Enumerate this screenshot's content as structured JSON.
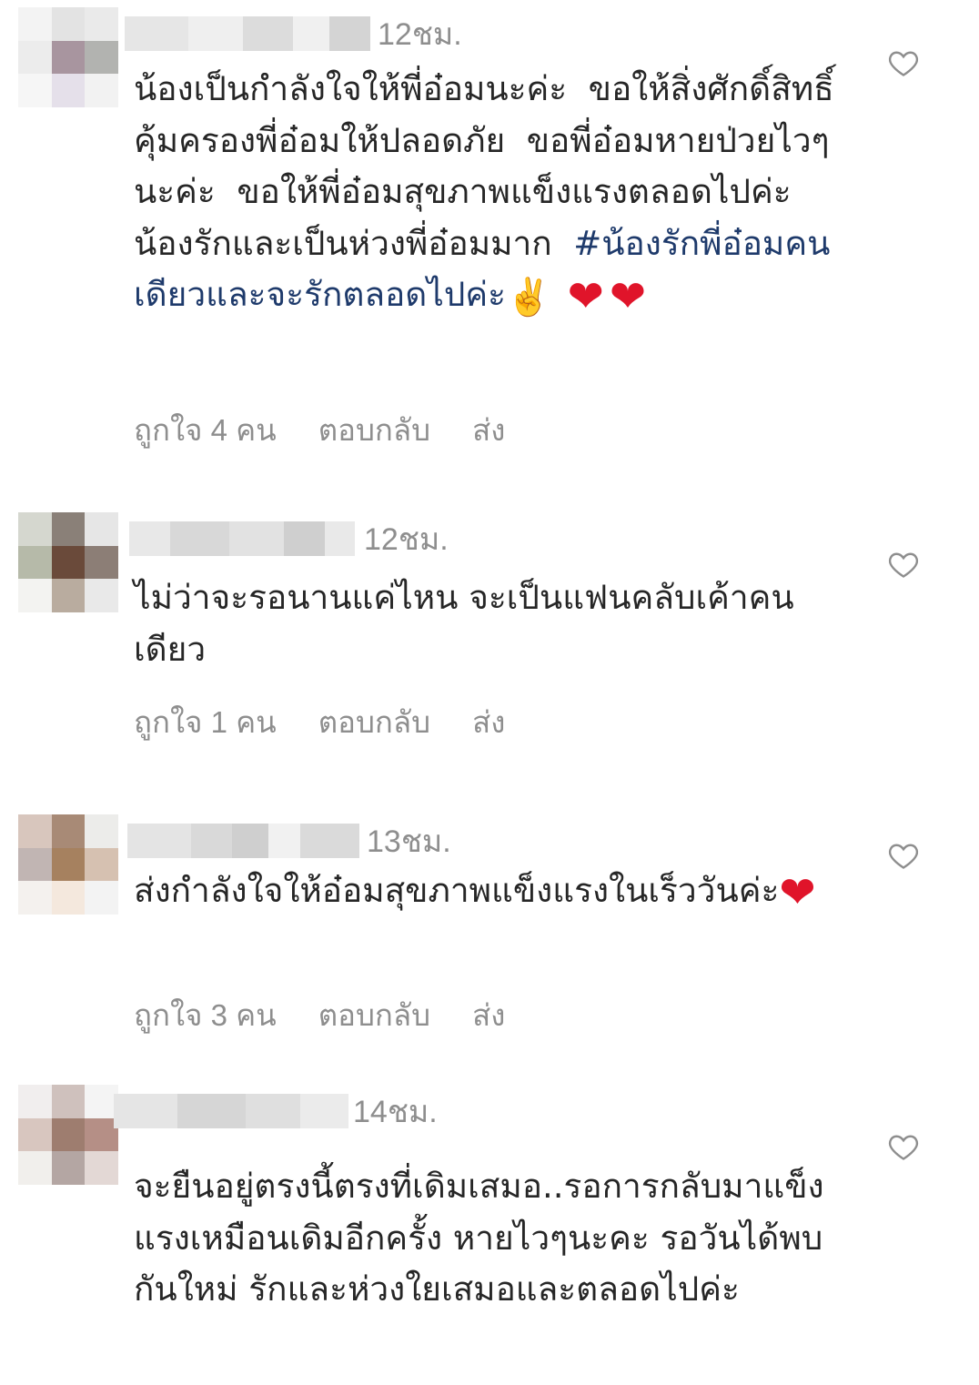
{
  "comments": [
    {
      "time": "12ชม.",
      "text": "น้องเป็นกำลังใจให้พี่อ๋อมนะค่ะ  ขอให้สิ่งศักดิ์สิทธิ์คุ้มครองพี่อ๋อมให้ปลอดภัย  ขอพี่อ๋อมหายป่วยไวๆนะค่ะ  ขอให้พี่อ๋อมสุขภาพแข็งแรงตลอดไปค่ะ  น้องรักและเป็นห่วงพี่อ๋อมมาก  ",
      "hashtag": "#น้องรักพี่อ๋อมคนเดียวและจะรักตลอดไปค่ะ",
      "likes": "ถูกใจ 4 คน",
      "reply": "ตอบกลับ",
      "send": "ส่ง"
    },
    {
      "time": "12ชม.",
      "text": "ไม่ว่าจะรอนานแค่ไหน จะเป็นแฟนคลับเค้าคนเดียว",
      "likes": "ถูกใจ 1 คน",
      "reply": "ตอบกลับ",
      "send": "ส่ง"
    },
    {
      "time": "13ชม.",
      "text": "ส่งกำลังใจให้อ๋อมสุขภาพแข็งแรงในเร็ววันค่ะ",
      "likes": "ถูกใจ 3 คน",
      "reply": "ตอบกลับ",
      "send": "ส่ง"
    },
    {
      "time": "14ชม.",
      "text": "จะยืนอยู่ตรงนี้ตรงที่เดิมเสมอ..รอการกลับมาแข็งแรงเหมือนเดิมอีกครั้ง หายไวๆนะคะ รอวันได้พบกันใหม่ รักและห่วงใยเสมอและตลอดไปค่ะ"
    }
  ],
  "emoji": {
    "victory": "✌️",
    "heart": "❤"
  },
  "colors": {
    "text": "#262626",
    "muted": "#8e8e8e",
    "hashtag": "#1e3a6b",
    "heart": "#e0142a"
  },
  "icons": {
    "like": "heart-outline-icon"
  }
}
